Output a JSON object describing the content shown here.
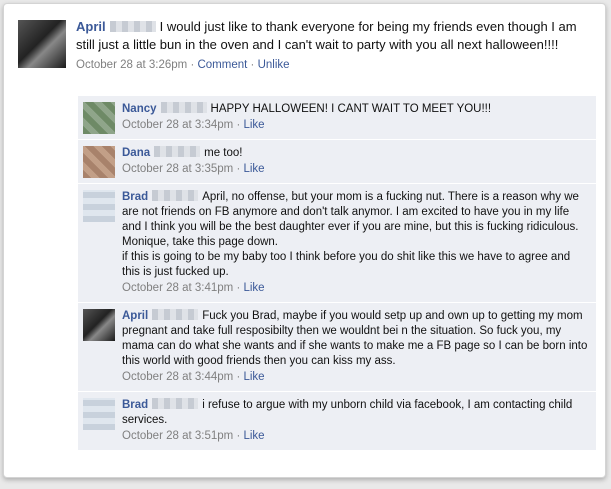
{
  "post": {
    "author": "April",
    "text": "I would just like to thank everyone for being my friends even though I am still just a little bun in the oven and I can't wait to party with you all next halloween!!!!",
    "time": "October 28 at 3:26pm",
    "comment_link": "Comment",
    "unlike_link": "Unlike"
  },
  "comments": [
    {
      "author": "Nancy",
      "text": "HAPPY HALLOWEEN! I CANT WAIT TO MEET YOU!!!",
      "time": "October 28 at 3:34pm",
      "like": "Like"
    },
    {
      "author": "Dana",
      "text": "me too!",
      "time": "October 28 at 3:35pm",
      "like": "Like"
    },
    {
      "author": "Brad",
      "text": "April, no offense, but your mom is a fucking nut. There is a reason why we are not friends on FB anymore and don't talk anymor. I am excited to have you in my life and I think you will be the best daughter ever if you are mine, but this is fucking ridiculous. Monique, take this page down.",
      "text2": "if this is going to be my baby too I think before you do shit like this we have to agree and this is just fucked up.",
      "time": "October 28 at 3:41pm",
      "like": "Like"
    },
    {
      "author": "April",
      "text": "Fuck you Brad, maybe if you would setp up and own up to getting my mom pregnant and take full resposibilty then we wouldnt bei n the situation. So fuck you, my mama can do what she wants and if she wants to make me a FB page so I can be born into this world with good friends then you can kiss my ass.",
      "time": "October 28 at 3:44pm",
      "like": "Like"
    },
    {
      "author": "Brad",
      "text": "i refuse to argue with my unborn child via facebook, I am contacting child services.",
      "time": "October 28 at 3:51pm",
      "like": "Like"
    }
  ],
  "separator": "·"
}
